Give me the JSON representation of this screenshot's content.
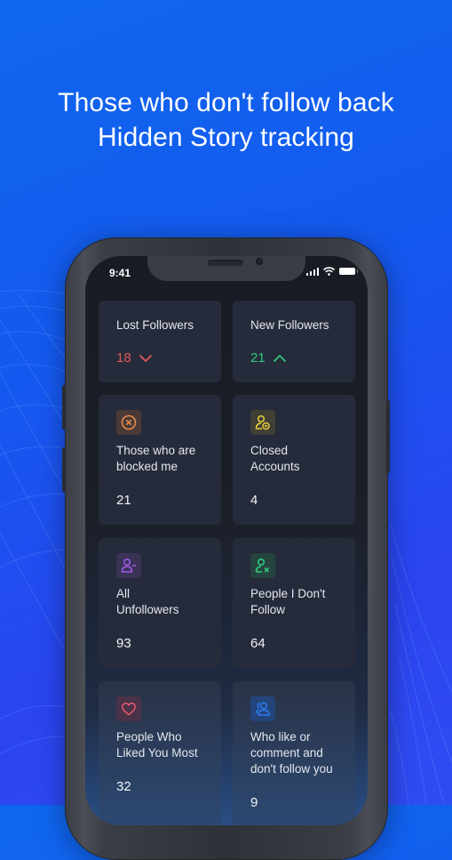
{
  "headline": {
    "line1": "Those who don't follow back",
    "line2": "Hidden Story tracking"
  },
  "status_bar": {
    "time": "9:41",
    "icons": [
      "cellular-signal-icon",
      "wifi-icon",
      "battery-icon"
    ]
  },
  "colors": {
    "background_start": "#0f66ee",
    "background_end": "#2f4cf2",
    "card_bg": "#252b3a",
    "loss_red": "#e0595e",
    "gain_green": "#2fc77d"
  },
  "stats": {
    "lost_followers": {
      "label": "Lost Followers",
      "value": "18",
      "trend": "down",
      "icon": "chevron-down-icon"
    },
    "new_followers": {
      "label": "New Followers",
      "value": "21",
      "trend": "up",
      "icon": "chevron-up-icon"
    }
  },
  "cards": [
    {
      "id": "blocked-me",
      "title_lines": [
        "Those who are",
        "blocked me"
      ],
      "count": "21",
      "icon": "blocked-circle-x-icon",
      "icon_color": "#e98a4b",
      "tile_color": "#4a3a36"
    },
    {
      "id": "closed-accounts",
      "title_lines": [
        "Closed",
        "Accounts"
      ],
      "count": "4",
      "icon": "user-lock-icon",
      "icon_color": "#e8cf3a",
      "tile_color": "#3f3f35"
    },
    {
      "id": "all-unfollowers",
      "title_lines": [
        "All",
        "Unfollowers"
      ],
      "count": "93",
      "icon": "user-minus-icon",
      "icon_color": "#a35bea",
      "tile_color": "#3a3356"
    },
    {
      "id": "people-i-dont-follow",
      "title_lines": [
        "People I Don't",
        "Follow"
      ],
      "count": "64",
      "icon": "user-x-icon",
      "icon_color": "#2fd07f",
      "tile_color": "#24443d"
    },
    {
      "id": "liked-you-most",
      "title_lines": [
        "People Who",
        "Liked You Most"
      ],
      "count": "32",
      "icon": "heart-icon",
      "icon_color": "#ea5a72",
      "tile_color": "#4a3248"
    },
    {
      "id": "like-comment-not-follow",
      "title_lines": [
        "Who like or",
        "comment and",
        "don't follow you"
      ],
      "count": "9",
      "icon": "users-icon",
      "icon_color": "#2d7bf0",
      "tile_color": "#24457c"
    }
  ]
}
